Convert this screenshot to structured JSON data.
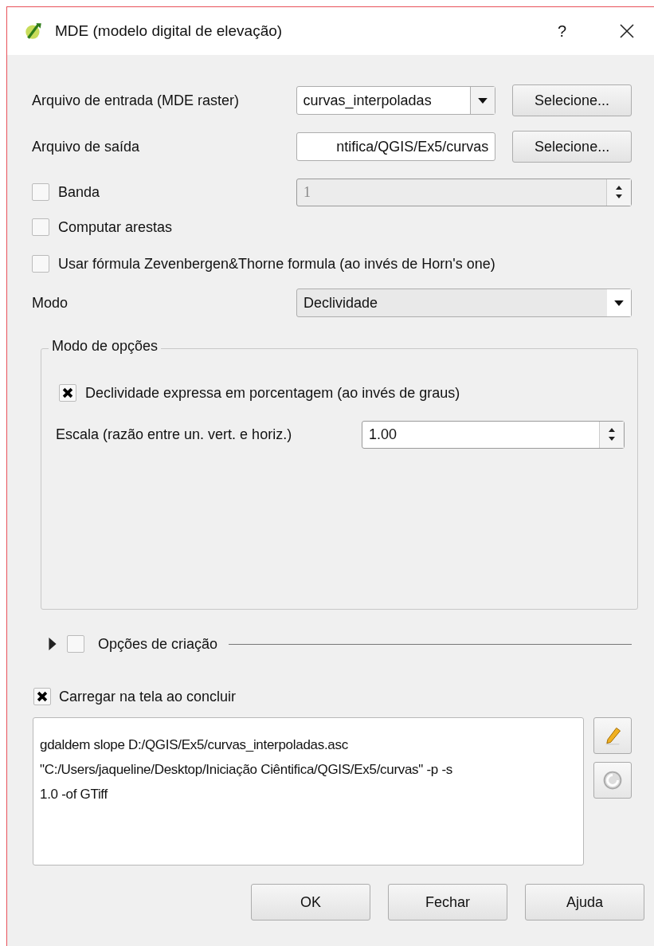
{
  "window": {
    "title": "MDE (modelo digital de elevação)",
    "help": "?"
  },
  "input_file": {
    "label": "Arquivo de entrada (MDE raster)",
    "value": "curvas_interpoladas",
    "button": "Selecione..."
  },
  "output_file": {
    "label": "Arquivo de saída",
    "value": "ntifica/QGIS/Ex5/curvas",
    "button": "Selecione..."
  },
  "band": {
    "label": "Banda",
    "checked": false,
    "value": "1",
    "disabled": true
  },
  "options": [
    {
      "label": "Computar arestas",
      "checked": false
    },
    {
      "label": "Usar fórmula Zevenbergen&Thorne formula (ao invés de Horn's one)",
      "checked": false
    }
  ],
  "mode": {
    "label": "Modo",
    "value": "Declividade"
  },
  "mode_options": {
    "title": "Modo de opções",
    "items": [
      {
        "kind": "checkbox",
        "label": "Declividade expressa em porcentagem (ao invés de graus)",
        "checked": true
      },
      {
        "kind": "spin",
        "label": "Escala (razão entre un. vert. e horiz.)",
        "value": "1.00"
      }
    ]
  },
  "creation_options": {
    "label": "Opções de criação",
    "expanded": false,
    "checked": false
  },
  "load_on_finish": {
    "label": "Carregar na tela ao concluir",
    "checked": true
  },
  "command": "gdaldem slope D:/QGIS/Ex5/curvas_interpoladas.asc\n\"C:/Users/jaqueline/Desktop/Iniciação Ciêntifica/QGIS/Ex5/curvas\" -p -s\n1.0 -of GTiff",
  "buttons": [
    "OK",
    "Fechar",
    "Ajuda"
  ]
}
